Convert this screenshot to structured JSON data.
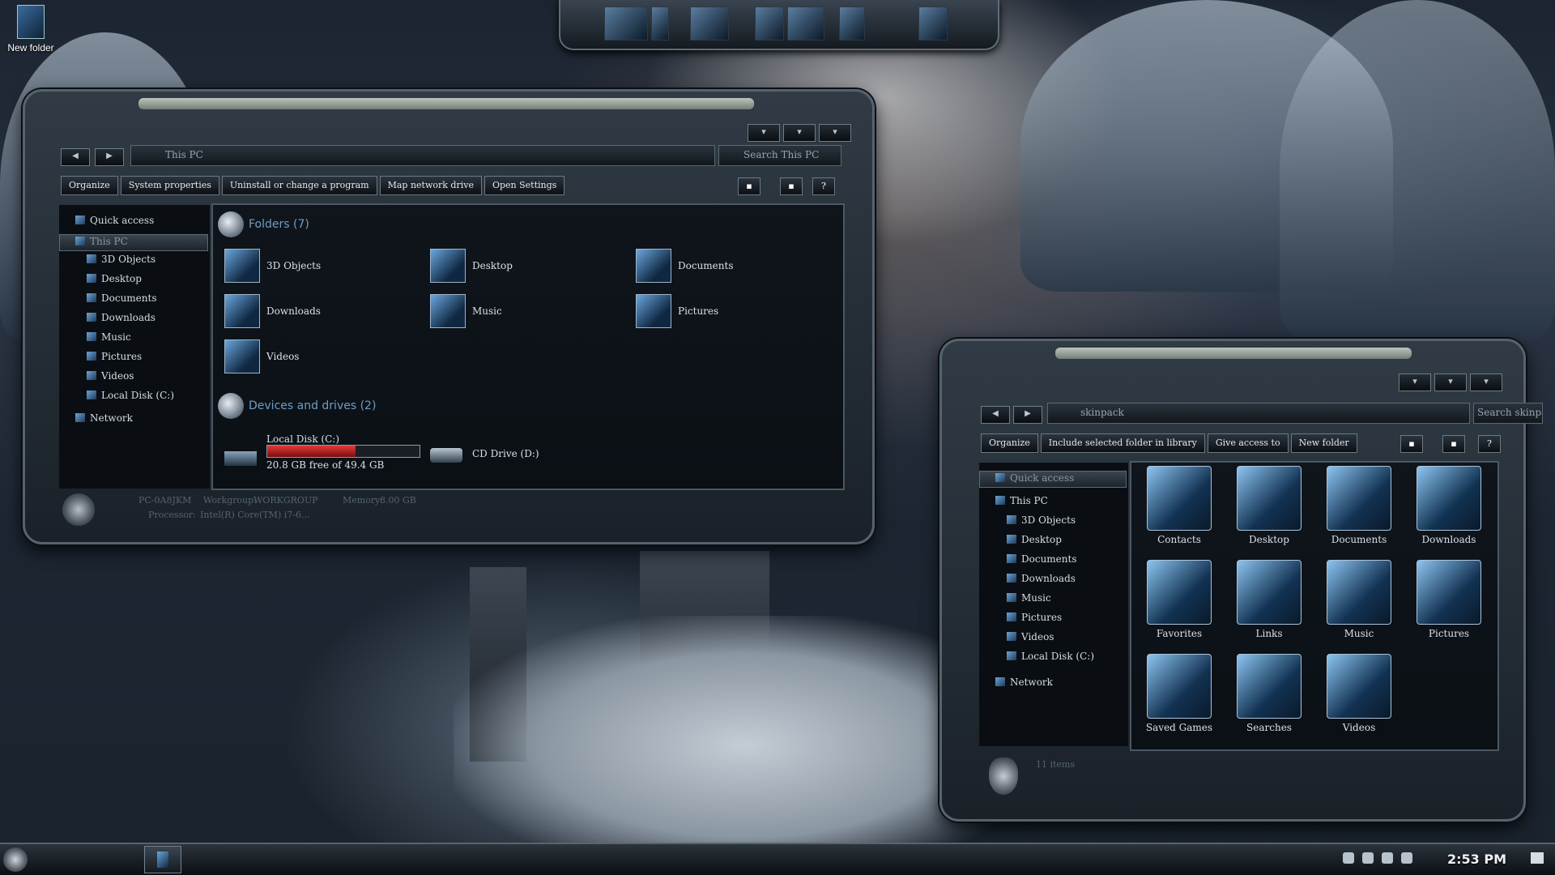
{
  "desktop": {
    "icon_label": "New folder"
  },
  "window1": {
    "address": "This PC",
    "search_placeholder": "Search This PC",
    "commands": [
      "Organize",
      "System properties",
      "Uninstall or change a program",
      "Map network drive",
      "Open Settings"
    ],
    "nav": {
      "quick_access": "Quick access",
      "this_pc": "This PC",
      "items": [
        "3D Objects",
        "Desktop",
        "Documents",
        "Downloads",
        "Music",
        "Pictures",
        "Videos",
        "Local Disk (C:)"
      ],
      "network": "Network"
    },
    "folders_header": "Folders (7)",
    "folders": [
      "3D Objects",
      "Desktop",
      "Documents",
      "Downloads",
      "Music",
      "Pictures",
      "Videos"
    ],
    "devices_header": "Devices and drives (2)",
    "drive_c": {
      "name": "Local Disk (C:)",
      "free": "20.8 GB free of 49.4 GB",
      "used_fraction": 0.58
    },
    "drive_d": {
      "name": "CD Drive (D:)"
    },
    "details": {
      "pc_label": "PC-0A8JKM",
      "workgroup_label": "Workgroup:",
      "workgroup": "WORKGROUP",
      "memory_label": "Memory:",
      "memory": "8.00 GB",
      "processor_label": "Processor:",
      "processor": "Intel(R) Core(TM) i7-6..."
    }
  },
  "window2": {
    "address": "skinpack",
    "search_placeholder": "Search skinpack",
    "commands": [
      "Organize",
      "Include selected folder in library",
      "Give access to",
      "New folder"
    ],
    "nav": {
      "quick_access": "Quick access",
      "this_pc": "This PC",
      "items": [
        "3D Objects",
        "Desktop",
        "Documents",
        "Downloads",
        "Music",
        "Pictures",
        "Videos",
        "Local Disk (C:)"
      ],
      "network": "Network"
    },
    "items": [
      "Contacts",
      "Desktop",
      "Documents",
      "Downloads",
      "Favorites",
      "Links",
      "Music",
      "Pictures",
      "Saved Games",
      "Searches",
      "Videos"
    ],
    "status": "11 items"
  },
  "taskbar": {
    "clock": "2:53 PM"
  },
  "colors": {
    "accent": "#6f9dc8",
    "drive_bar": "#c41e1e",
    "frame": "#56636e"
  }
}
